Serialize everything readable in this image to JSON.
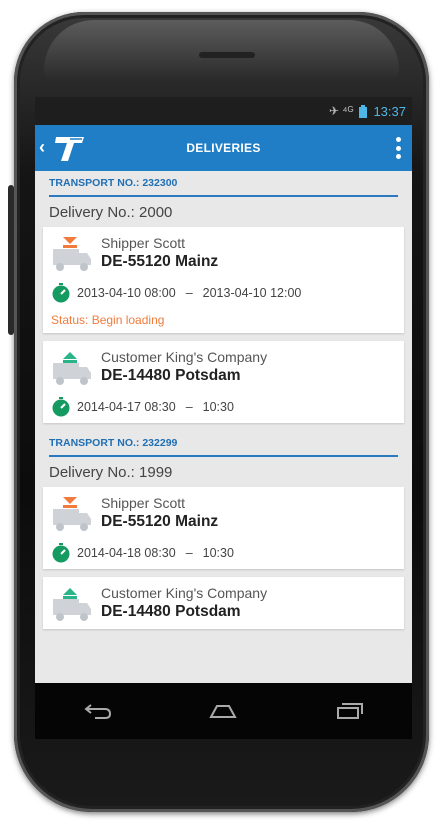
{
  "status_bar": {
    "signal": "✈ ⁴ᴳ",
    "time": "13:37"
  },
  "app_bar": {
    "back": "‹",
    "title": "DELIVERIES"
  },
  "groups": [
    {
      "transport": "TRANSPORT NO.: 232300",
      "delivery": "Delivery No.: 2000",
      "cards": [
        {
          "type": "shipper",
          "name": "Shipper Scott",
          "address": "DE-55120 Mainz",
          "start": "2013-04-10  08:00",
          "sep": "–",
          "end": "2013-04-10  12:00",
          "status": "Status: Begin loading"
        },
        {
          "type": "customer",
          "name": "Customer King's Company",
          "address": "DE-14480 Potsdam",
          "start": "2014-04-17  08:30",
          "sep": "–",
          "end": "10:30"
        }
      ]
    },
    {
      "transport": "TRANSPORT NO.: 232299",
      "delivery": "Delivery No.: 1999",
      "cards": [
        {
          "type": "shipper",
          "name": "Shipper Scott",
          "address": "DE-55120 Mainz",
          "start": "2014-04-18  08:30",
          "sep": "–",
          "end": "10:30"
        },
        {
          "type": "customer",
          "name": "Customer King's Company",
          "address": "DE-14480 Potsdam"
        }
      ]
    }
  ],
  "colors": {
    "accent": "#1f7ec6",
    "status": "#f07b3c",
    "shipper_arrow": "#f07b3c",
    "customer_arrow": "#2bb38a",
    "clock": "#159a62"
  },
  "icons": {
    "back": "back-chevron-icon",
    "menu": "overflow-menu-icon",
    "truck": "truck-icon",
    "clock": "clock-icon",
    "nav_back": "nav-back-icon",
    "nav_home": "nav-home-icon",
    "nav_recents": "nav-recents-icon"
  }
}
